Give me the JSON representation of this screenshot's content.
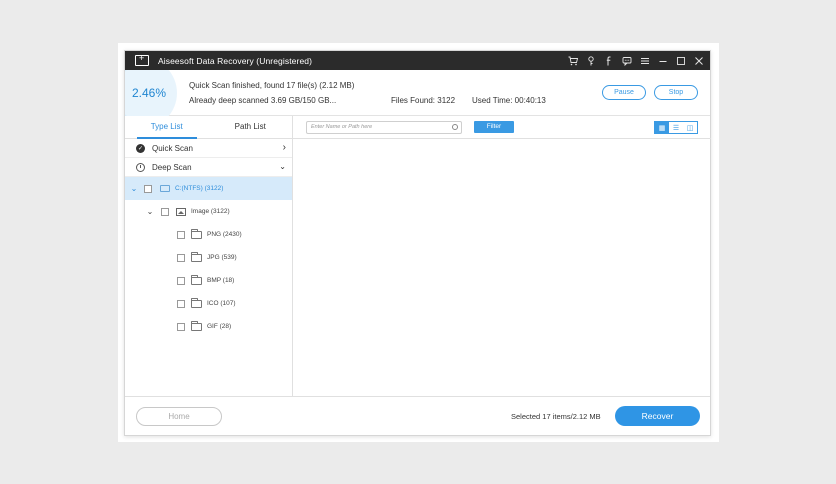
{
  "window": {
    "title": "Aiseesoft Data Recovery (Unregistered)"
  },
  "titlebar_icons": [
    "cart-icon",
    "key-icon",
    "facebook-icon",
    "chat-icon",
    "menu-icon",
    "minimize-icon",
    "maximize-icon",
    "close-icon"
  ],
  "status": {
    "progress": "2.46%",
    "line1": "Quick Scan finished, found 17 file(s) (2.12 MB)",
    "line2": "Already deep scanned 3.69 GB/150 GB...",
    "files_found": "Files Found: 3122",
    "used_time": "Used Time: 00:40:13"
  },
  "buttons": {
    "pause": "Pause",
    "stop": "Stop",
    "filter": "Filter",
    "home": "Home",
    "recover": "Recover"
  },
  "tabs": {
    "type_list": "Type List",
    "path_list": "Path List"
  },
  "scan_modes": {
    "quick": "Quick Scan",
    "deep": "Deep Scan"
  },
  "tree": {
    "drive": "C:(NTFS) (3122)",
    "category": "Image (3122)",
    "items": [
      "PNG (2430)",
      "JPG (539)",
      "BMP (18)",
      "ICO (107)",
      "GIF (28)"
    ]
  },
  "search": {
    "placeholder": "Enter Name or Path here"
  },
  "footer": {
    "selected": "Selected 17 items/2.12 MB"
  },
  "colors": {
    "accent": "#2e8ddb",
    "titlebar": "#2b2b2b",
    "selection": "#d6eafa"
  }
}
